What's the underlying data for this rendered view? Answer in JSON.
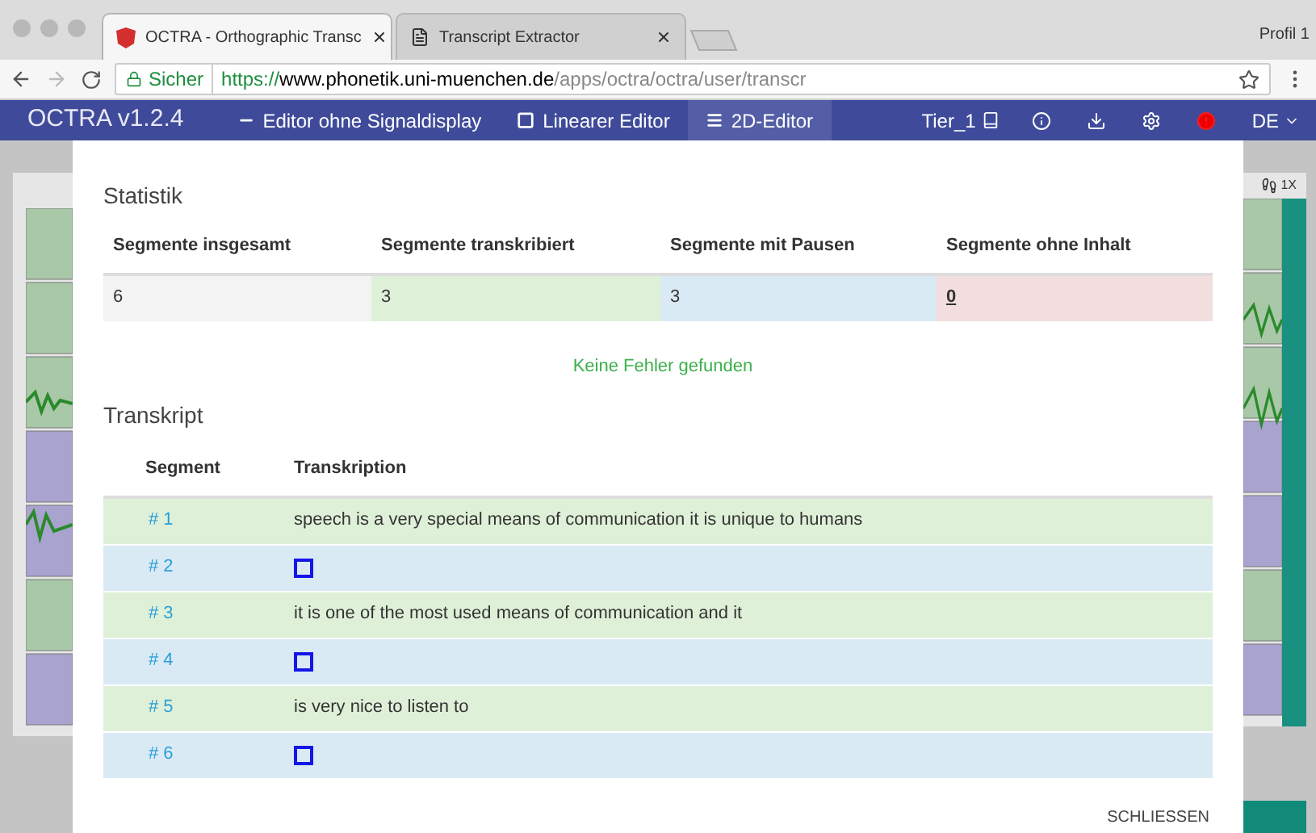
{
  "browser": {
    "tabs": [
      {
        "title": "OCTRA - Orthographic Transc",
        "selected": true
      },
      {
        "title": "Transcript Extractor",
        "selected": false
      }
    ],
    "profile": "Profil 1",
    "secure_label": "Sicher",
    "url_scheme": "https://",
    "url_host": "www.phonetik.uni-muenchen.de",
    "url_path": "/apps/octra/octra/user/transcr"
  },
  "navbar": {
    "brand": "OCTRA v1.2.4",
    "items": [
      {
        "label": "Editor ohne Signaldisplay",
        "selected": false
      },
      {
        "label": "Linearer Editor",
        "selected": false
      },
      {
        "label": "2D-Editor",
        "selected": true
      }
    ],
    "tier": "Tier_1",
    "language": "DE"
  },
  "background": {
    "speed": "1X"
  },
  "modal": {
    "stats_title": "Statistik",
    "stats": [
      {
        "label": "Segmente insgesamt",
        "value": "6",
        "color": "#f3f3f3"
      },
      {
        "label": "Segmente transkribiert",
        "value": "3",
        "color": "#dff0d8"
      },
      {
        "label": "Segmente mit Pausen",
        "value": "3",
        "color": "#d9eaf5"
      },
      {
        "label": "Segmente ohne Inhalt",
        "value": "0",
        "color": "#f2dede"
      }
    ],
    "message": "Keine Fehler gefunden",
    "transcript_title": "Transkript",
    "columns": [
      "Segment",
      "Transkription"
    ],
    "rows": [
      {
        "segment": "# 1",
        "kind": "text",
        "text": "speech is a very special means of communication it is unique to humans"
      },
      {
        "segment": "# 2",
        "kind": "pause"
      },
      {
        "segment": "# 3",
        "kind": "text",
        "text": "it is one of the most used means of communication and it"
      },
      {
        "segment": "# 4",
        "kind": "pause"
      },
      {
        "segment": "# 5",
        "kind": "text",
        "text": "is very nice to listen to"
      },
      {
        "segment": "# 6",
        "kind": "pause"
      }
    ],
    "close": "SCHLIESSEN"
  }
}
